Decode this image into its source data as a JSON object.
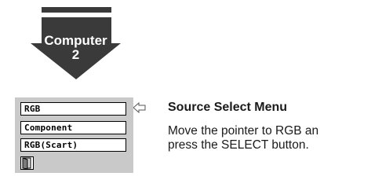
{
  "source_graphic": {
    "label_line1": "Computer",
    "label_line2": "2"
  },
  "source_menu": {
    "items": [
      {
        "label": "RGB",
        "selected": true
      },
      {
        "label": "Component"
      },
      {
        "label": "RGB(Scart)"
      }
    ],
    "pointer_icon": "left-arrow-pointer-icon",
    "exit_icon": "exit-door-icon"
  },
  "description": {
    "title": "Source Select Menu",
    "line1": "Move the pointer to RGB an",
    "line2": "press the SELECT button."
  },
  "colors": {
    "panel": "#c9c9c9",
    "graphic": "#3a3a3a"
  }
}
